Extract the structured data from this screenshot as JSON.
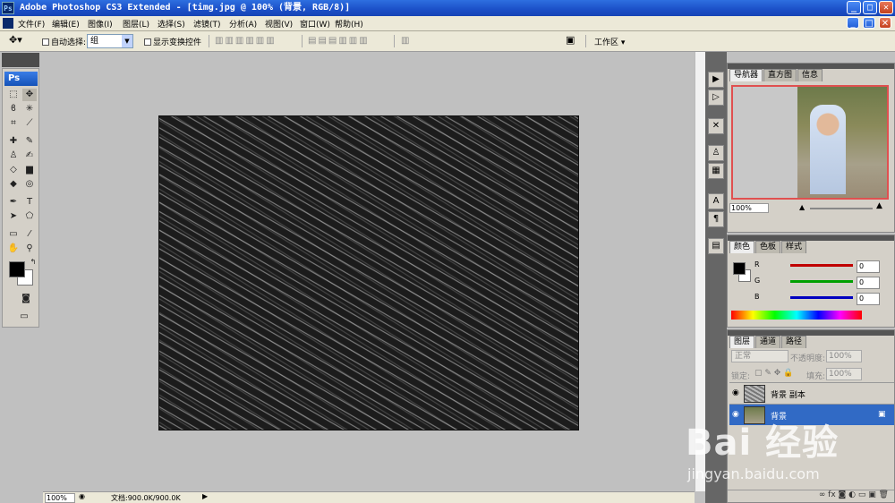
{
  "window": {
    "title": "Adobe Photoshop CS3 Extended - [timg.jpg @ 100% (背景, RGB/8)]"
  },
  "menu": [
    "文件(F)",
    "编辑(E)",
    "图像(I)",
    "图层(L)",
    "选择(S)",
    "滤镜(T)",
    "分析(A)",
    "视图(V)",
    "窗口(W)",
    "帮助(H)"
  ],
  "options": {
    "auto_select_label": "自动选择:",
    "auto_select_value": "组",
    "show_transform_label": "显示变换控件",
    "workspace_label": "工作区 ▾"
  },
  "toolbox": {
    "logo": "Ps"
  },
  "status": {
    "zoom": "100%",
    "doc": "文档:900.0K/900.0K"
  },
  "navigator": {
    "tabs": [
      "导航器",
      "直方图",
      "信息"
    ],
    "zoom": "100%"
  },
  "color_panel": {
    "tabs": [
      "颜色",
      "色板",
      "样式"
    ],
    "channels": [
      {
        "label": "R",
        "value": "0",
        "color": "#c00000"
      },
      {
        "label": "G",
        "value": "0",
        "color": "#00a000"
      },
      {
        "label": "B",
        "value": "0",
        "color": "#0000c0"
      }
    ]
  },
  "layers_panel": {
    "tabs": [
      "图层",
      "通道",
      "路径"
    ],
    "blend_mode": "正常",
    "opacity_label": "不透明度:",
    "opacity_value": "100%",
    "lock_label": "锁定:",
    "fill_label": "填充:",
    "fill_value": "100%",
    "layers": [
      {
        "name": "背景 副本",
        "selected": false
      },
      {
        "name": "背景",
        "selected": true
      }
    ]
  },
  "watermark": {
    "text": "Bai 经验",
    "sub": "jingyan.baidu.com"
  }
}
